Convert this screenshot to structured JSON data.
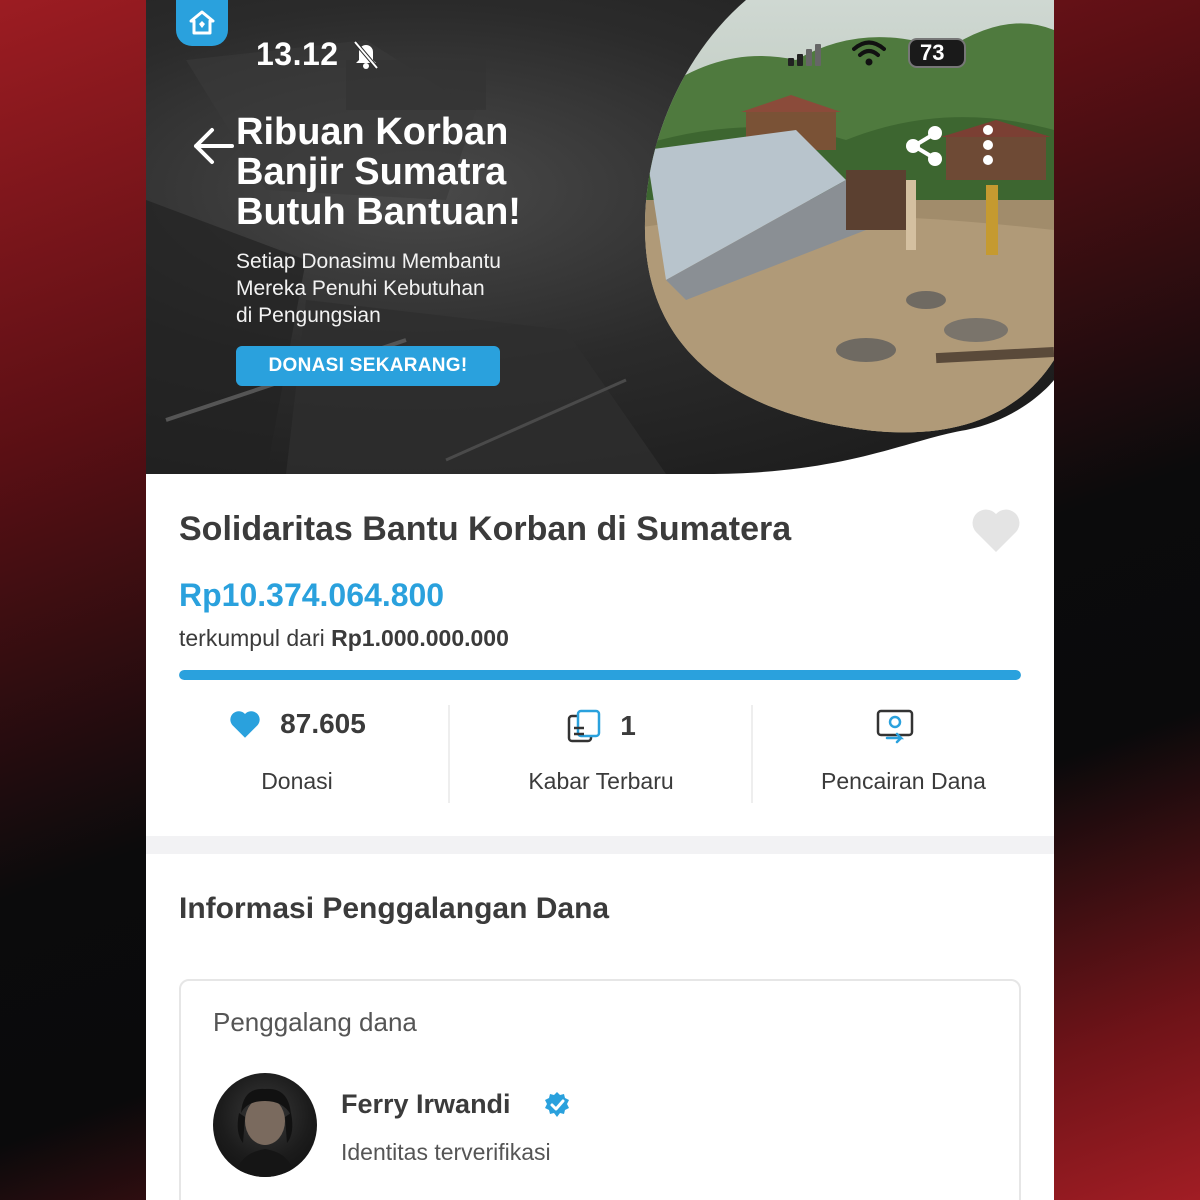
{
  "status_bar": {
    "time": "13.12",
    "battery": "73",
    "icons": [
      "bell-muted-icon",
      "signal-icon",
      "wifi-icon",
      "battery-icon"
    ]
  },
  "banner": {
    "title_lines": [
      "Ribuan Korban",
      "Banjir Sumatra",
      "Butuh Bantuan!"
    ],
    "subtitle_lines": [
      "Setiap Donasimu Membantu",
      "Mereka Penuhi Kebutuhan",
      "di Pengungsian"
    ],
    "cta_label": "DONASI SEKARANG!",
    "icons": [
      "back-arrow-icon",
      "share-icon",
      "more-vertical-icon"
    ]
  },
  "campaign": {
    "title": "Solidaritas Bantu Korban di Sumatera",
    "collected": "Rp10.374.064.800",
    "target_prefix": "terkumpul dari ",
    "target_amount": "Rp1.000.000.000",
    "progress_fraction": 1.0
  },
  "stats": [
    {
      "value": "87.605",
      "label": "Donasi",
      "icon": "heart-icon"
    },
    {
      "value": "1",
      "label": "Kabar Terbaru",
      "icon": "news-icon"
    },
    {
      "value": "",
      "label": "Pencairan Dana",
      "icon": "disbursement-icon"
    }
  ],
  "info_section": {
    "title": "Informasi Penggalangan Dana",
    "card_label": "Penggalang dana",
    "fundraiser_name": "Ferry Irwandi",
    "fundraiser_status": "Identitas terverifikasi"
  },
  "colors": {
    "accent": "#2aa1dd",
    "text": "#3b3b3b",
    "background_frame": "#9c1c22"
  }
}
